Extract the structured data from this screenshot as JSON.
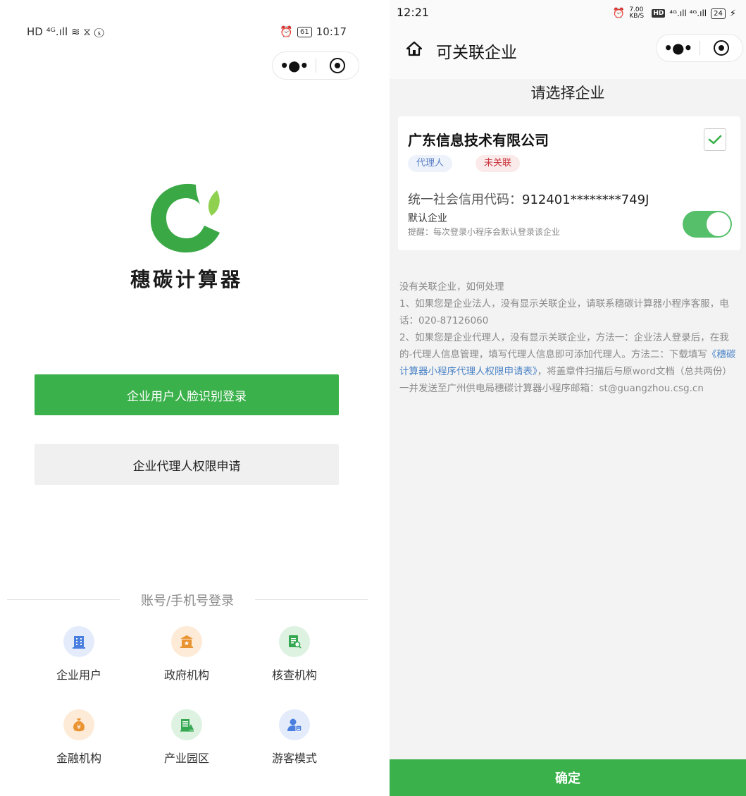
{
  "left_screen": {
    "status_bar": {
      "left_icons": "HD ⁴ᴳ.ıll ≋ ⧖ ⓢ",
      "battery": "61",
      "time": "10:17"
    },
    "capsule": {
      "more_glyph": "•●•"
    },
    "app_name": "穗碳计算器",
    "colors": {
      "brand_green": "#3ab14a"
    },
    "face_login_button": "企业用户人脸识别登录",
    "agent_apply_button": "企业代理人权限申请",
    "account_login_divider": "账号/手机号登录",
    "login_types": [
      {
        "label": "企业用户",
        "icon": "building-icon"
      },
      {
        "label": "政府机构",
        "icon": "government-icon"
      },
      {
        "label": "核查机构",
        "icon": "audit-icon"
      },
      {
        "label": "金融机构",
        "icon": "money-bag-icon"
      },
      {
        "label": "产业园区",
        "icon": "park-icon"
      },
      {
        "label": "游客模式",
        "icon": "visitor-icon"
      }
    ]
  },
  "right_screen": {
    "status_bar": {
      "time": "12:21",
      "speed": "7.00 KB/S",
      "battery": "24"
    },
    "nav_title": "可关联企业",
    "capsule": {
      "more_glyph": "•●•"
    },
    "sub_title": "请选择企业",
    "company": {
      "name": "广东信息技术有限公司",
      "tag_agent": "代理人",
      "tag_unlinked": "未关联",
      "credit_label": "统一社会信用代码：",
      "credit_value": "912401********749J",
      "default_label": "默认企业",
      "default_hint": "提醒：每次登录小程序会默认登录该企业",
      "checked": true,
      "default_on": true
    },
    "help": {
      "title": "没有关联企业，如何处理",
      "p1": "1、如果您是企业法人，没有显示关联企业，请联系穗碳计算器小程序客服，电话：020-87126060",
      "p2_before": "2、如果您是企业代理人，没有显示关联企业，方法一：企业法人登录后，在我的-代理人信息管理，填写代理人信息即可添加代理人。方法二：下载填写",
      "p2_link": "《穗碳计算器小程序代理人权限申请表》",
      "p2_after": "，将盖章件扫描后与原word文档（总共两份）一并发送至广州供电局穗碳计算器小程序邮箱：st@guangzhou.csg.cn"
    },
    "confirm_button": "确定"
  }
}
